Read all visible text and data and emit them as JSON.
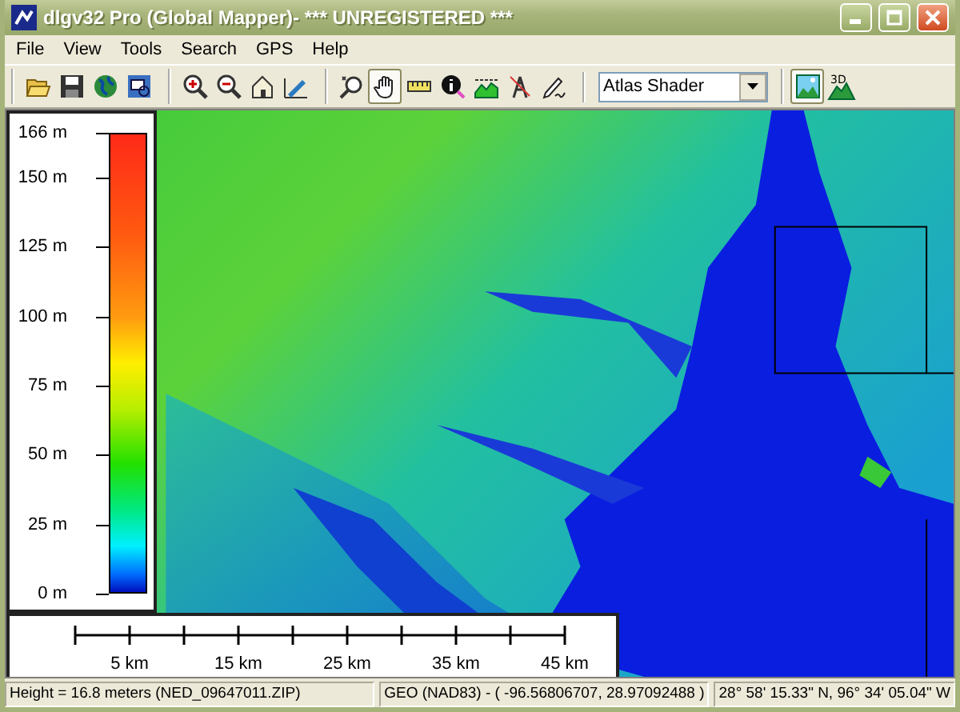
{
  "window": {
    "title": "dlgv32 Pro (Global Mapper)- *** UNREGISTERED ***"
  },
  "menu": [
    "File",
    "View",
    "Tools",
    "Search",
    "GPS",
    "Help"
  ],
  "toolbar_groups": [
    [
      {
        "kind": "open",
        "selected": false
      },
      {
        "kind": "save",
        "selected": false
      },
      {
        "kind": "globe",
        "selected": false
      },
      {
        "kind": "screen",
        "selected": false
      }
    ],
    [
      {
        "kind": "zoomin",
        "selected": false
      },
      {
        "kind": "zoomout",
        "selected": false
      },
      {
        "kind": "home",
        "selected": false
      },
      {
        "kind": "digitize",
        "selected": false
      }
    ],
    [
      {
        "kind": "zoombox",
        "selected": false
      },
      {
        "kind": "hand",
        "selected": true
      },
      {
        "kind": "ruler",
        "selected": false
      },
      {
        "kind": "info",
        "selected": false
      },
      {
        "kind": "profile",
        "selected": false
      },
      {
        "kind": "tower",
        "selected": false
      },
      {
        "kind": "pen",
        "selected": false
      }
    ]
  ],
  "shader_select": {
    "value": "Atlas Shader"
  },
  "view_buttons": [
    {
      "kind": "view2d",
      "selected": true
    },
    {
      "kind": "view3d",
      "label": "3D",
      "selected": false
    }
  ],
  "legend": {
    "labels": [
      "166 m",
      "150 m",
      "125 m",
      "100 m",
      "75 m",
      "50 m",
      "25 m",
      "0 m"
    ]
  },
  "scale_bar": {
    "labels": [
      "5 km",
      "15 km",
      "25 km",
      "35 km",
      "45 km"
    ]
  },
  "status_bar": [
    "Height = 16.8 meters (NED_09647011.ZIP)",
    "GEO (NAD83) - ( -96.56806707, 28.97092488 )",
    "28° 58' 15.33\" N, 96° 34' 05.04\" W"
  ]
}
